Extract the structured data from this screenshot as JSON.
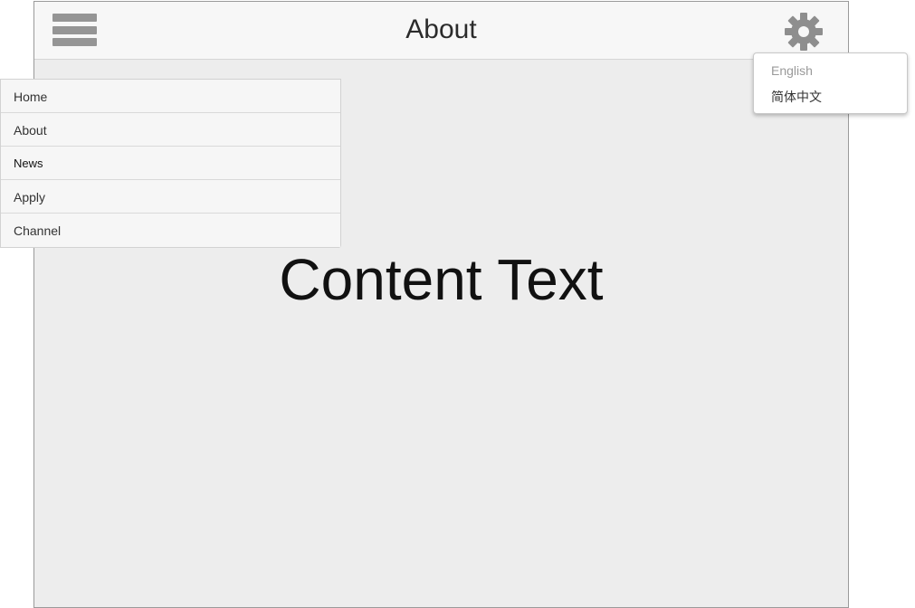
{
  "header": {
    "title": "About",
    "menu_icon": "hamburger-menu-icon",
    "settings_icon": "gear-icon"
  },
  "main": {
    "content_text": "Content Text"
  },
  "side_menu": {
    "items": [
      {
        "label": "Home"
      },
      {
        "label": "About"
      },
      {
        "label": "News"
      },
      {
        "label": "Apply"
      },
      {
        "label": "Channel"
      }
    ]
  },
  "language_menu": {
    "options": [
      {
        "label": "English",
        "state": "disabled"
      },
      {
        "label": "简体中文",
        "state": "enabled"
      }
    ]
  },
  "colors": {
    "content_background": "#ededed",
    "header_background": "#f7f7f7",
    "icon_gray": "#959595"
  }
}
